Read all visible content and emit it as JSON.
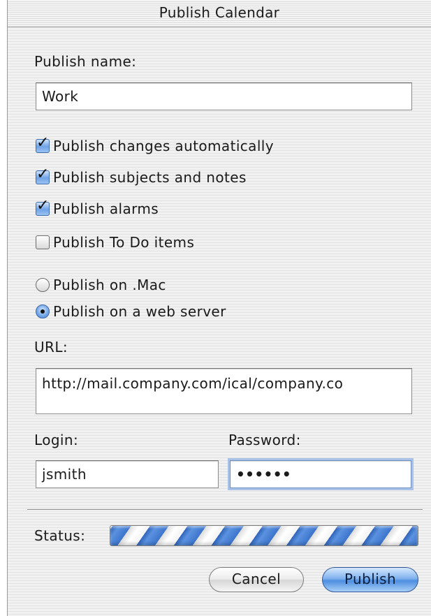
{
  "window": {
    "title": "Publish Calendar"
  },
  "publish_name": {
    "label": "Publish name:",
    "value": "Work"
  },
  "options": {
    "publish_changes": {
      "label": "Publish changes automatically",
      "checked": true
    },
    "publish_subjects": {
      "label": "Publish subjects and notes",
      "checked": true
    },
    "publish_alarms": {
      "label": "Publish alarms",
      "checked": true
    },
    "publish_todo": {
      "label": "Publish To Do items",
      "checked": false
    }
  },
  "destination": {
    "mac": {
      "label": "Publish on .Mac",
      "selected": false
    },
    "web_server": {
      "label": "Publish on a web server",
      "selected": true
    }
  },
  "url": {
    "label": "URL:",
    "value": "http://mail.company.com/ical/company.co"
  },
  "login": {
    "label": "Login:",
    "value": "jsmith"
  },
  "password": {
    "label": "Password:",
    "value": "••••••"
  },
  "status": {
    "label": "Status:",
    "state": "indeterminate"
  },
  "buttons": {
    "cancel": "Cancel",
    "publish": "Publish"
  },
  "colors": {
    "accent": "#4d8ee0",
    "focus_ring": "#a9c3e8"
  }
}
